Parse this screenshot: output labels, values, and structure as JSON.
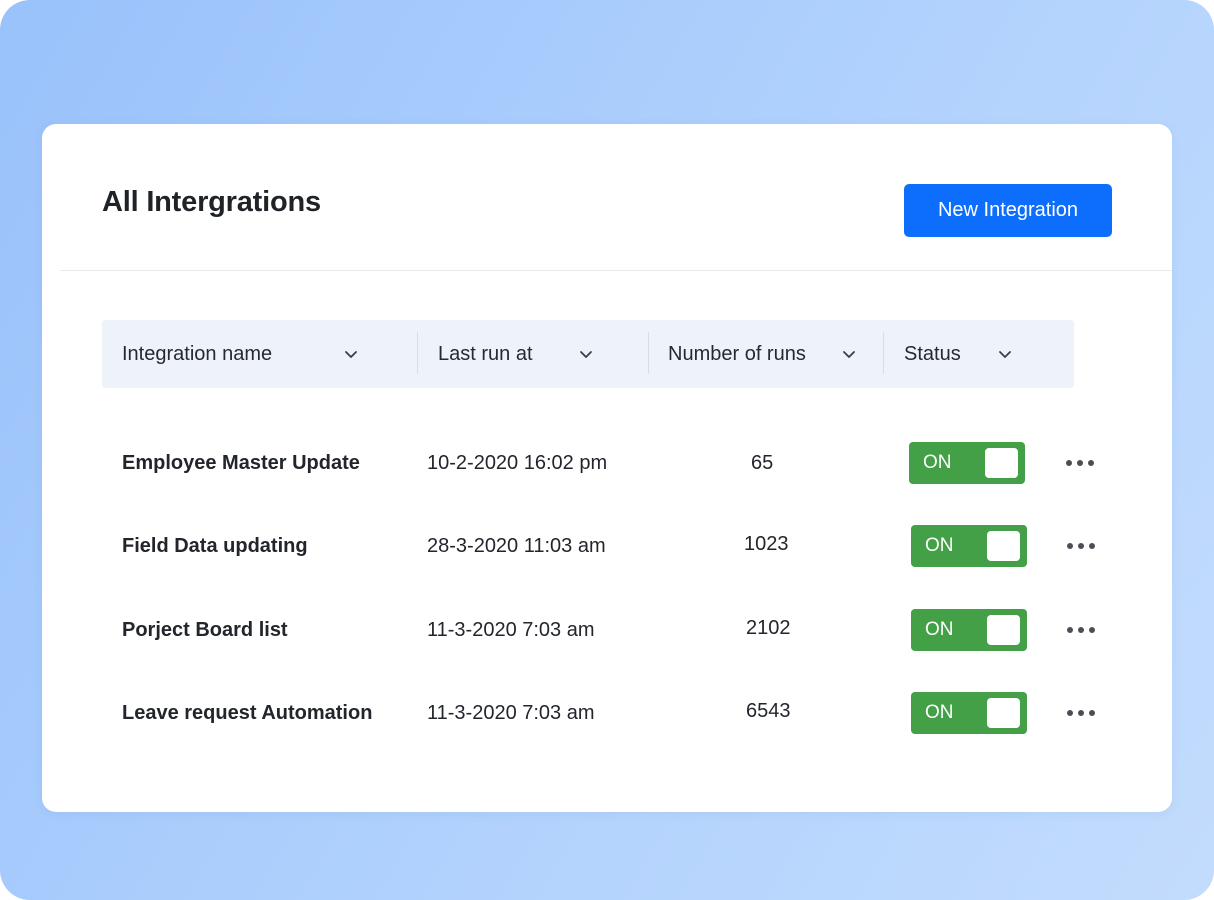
{
  "page": {
    "title": "All Intergrations",
    "new_button_label": "New Integration"
  },
  "table": {
    "columns": [
      {
        "label": "Integration name"
      },
      {
        "label": "Last run at"
      },
      {
        "label": "Number of runs"
      },
      {
        "label": "Status"
      }
    ],
    "rows": [
      {
        "name": "Employee Master Update",
        "last_run": "10-2-2020 16:02 pm",
        "runs": "65",
        "status": "ON"
      },
      {
        "name": "Field Data updating",
        "last_run": "28-3-2020 11:03 am",
        "runs": "1023",
        "status": "ON"
      },
      {
        "name": "Porject Board list",
        "last_run": "11-3-2020 7:03 am",
        "runs": "2102",
        "status": "ON"
      },
      {
        "name": "Leave request Automation",
        "last_run": "11-3-2020 7:03 am",
        "runs": "6543",
        "status": "ON"
      }
    ]
  },
  "icons": {
    "sort": "chevron-down-icon",
    "row_menu": "more-horizontal-icon"
  },
  "colors": {
    "primary": "#0d6efd",
    "status_on": "#43a047",
    "header_bg": "#eef3f9"
  }
}
